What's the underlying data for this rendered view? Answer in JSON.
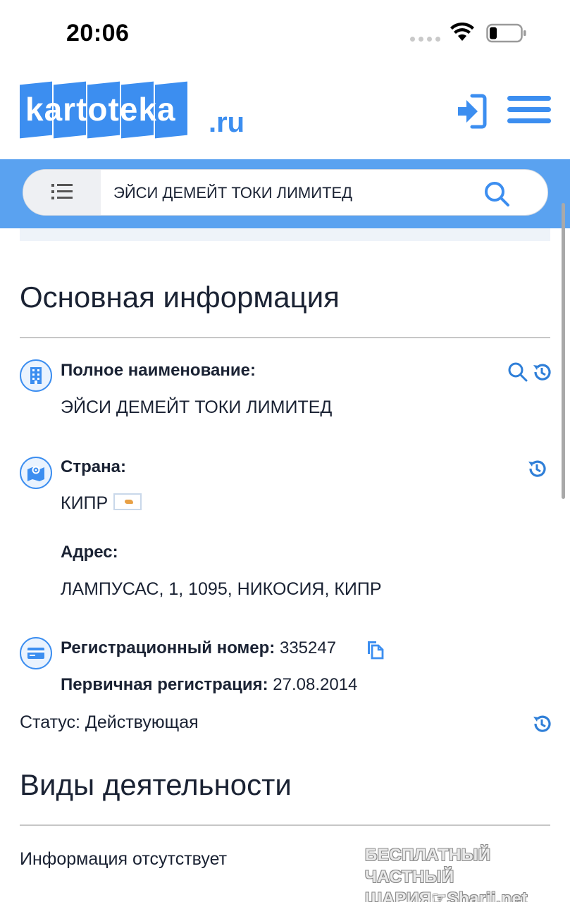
{
  "status_bar": {
    "time": "20:06"
  },
  "header": {
    "logo_text": "kartoteka",
    "logo_domain": ".ru",
    "brand_color": "#3c8ef0"
  },
  "search": {
    "value": "ЭЙСИ ДЕМЕЙТ ТОКИ ЛИМИТЕД",
    "band_color": "#5aa2f0"
  },
  "main_info": {
    "title": "Основная информация",
    "full_name_label": "Полное наименование:",
    "full_name_value": "ЭЙСИ ДЕМЕЙТ ТОКИ ЛИМИТЕД",
    "country_label": "Страна:",
    "country_value": "КИПР",
    "address_label": "Адрес:",
    "address_value": "ЛАМПУСАС, 1, 1095, НИКОСИЯ, КИПР",
    "reg_number_label": "Регистрационный номер:",
    "reg_number_value": "335247",
    "first_reg_label": "Первичная регистрация:",
    "first_reg_value": "27.08.2014",
    "status_text": "Статус: Действующая"
  },
  "activities": {
    "title": "Виды деятельности",
    "empty_text": "Информация отсутствует"
  },
  "watermark": {
    "line1": "БЕСПЛАТНЫЙ ЧАСТНЫЙ",
    "line2_prefix": "ШАРИЯ",
    "line2_suffix": "Sharij.net"
  }
}
